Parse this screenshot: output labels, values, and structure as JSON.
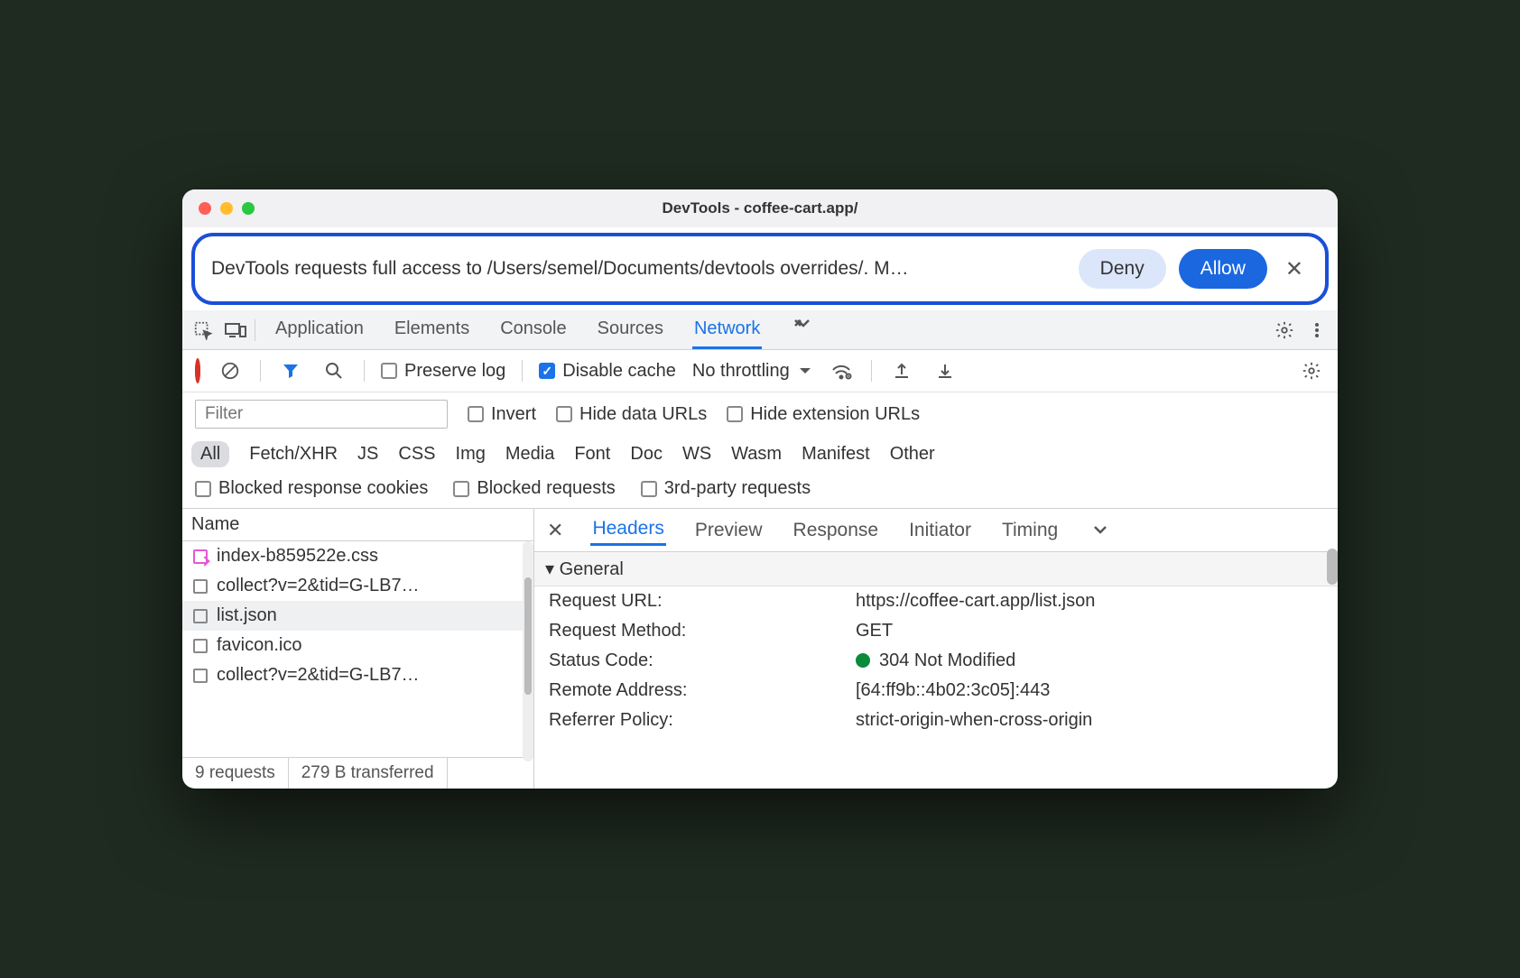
{
  "title": "DevTools - coffee-cart.app/",
  "alert": {
    "text": "DevTools requests full access to /Users/semel/Documents/devtools overrides/. M…",
    "deny": "Deny",
    "allow": "Allow"
  },
  "tabs": {
    "application": "Application",
    "elements": "Elements",
    "console": "Console",
    "sources": "Sources",
    "network": "Network"
  },
  "toolbar": {
    "preserve_log": "Preserve log",
    "disable_cache": "Disable cache",
    "throttling": "No throttling"
  },
  "filter": {
    "placeholder": "Filter",
    "invert": "Invert",
    "hide_data": "Hide data URLs",
    "hide_ext": "Hide extension URLs"
  },
  "types": {
    "all": "All",
    "fetch": "Fetch/XHR",
    "js": "JS",
    "css": "CSS",
    "img": "Img",
    "media": "Media",
    "font": "Font",
    "doc": "Doc",
    "ws": "WS",
    "wasm": "Wasm",
    "manifest": "Manifest",
    "other": "Other"
  },
  "options": {
    "blocked_cookies": "Blocked response cookies",
    "blocked_requests": "Blocked requests",
    "third_party": "3rd-party requests"
  },
  "name_col": {
    "header": "Name",
    "rows": [
      "index-b859522e.css",
      "collect?v=2&tid=G-LB7…",
      "list.json",
      "favicon.ico",
      "collect?v=2&tid=G-LB7…"
    ]
  },
  "status": {
    "requests": "9 requests",
    "transferred": "279 B transferred"
  },
  "detail_tabs": {
    "headers": "Headers",
    "preview": "Preview",
    "response": "Response",
    "initiator": "Initiator",
    "timing": "Timing"
  },
  "general": {
    "header": "General",
    "url_k": "Request URL:",
    "url_v": "https://coffee-cart.app/list.json",
    "method_k": "Request Method:",
    "method_v": "GET",
    "status_k": "Status Code:",
    "status_v": "304 Not Modified",
    "remote_k": "Remote Address:",
    "remote_v": "[64:ff9b::4b02:3c05]:443",
    "referrer_k": "Referrer Policy:",
    "referrer_v": "strict-origin-when-cross-origin"
  }
}
